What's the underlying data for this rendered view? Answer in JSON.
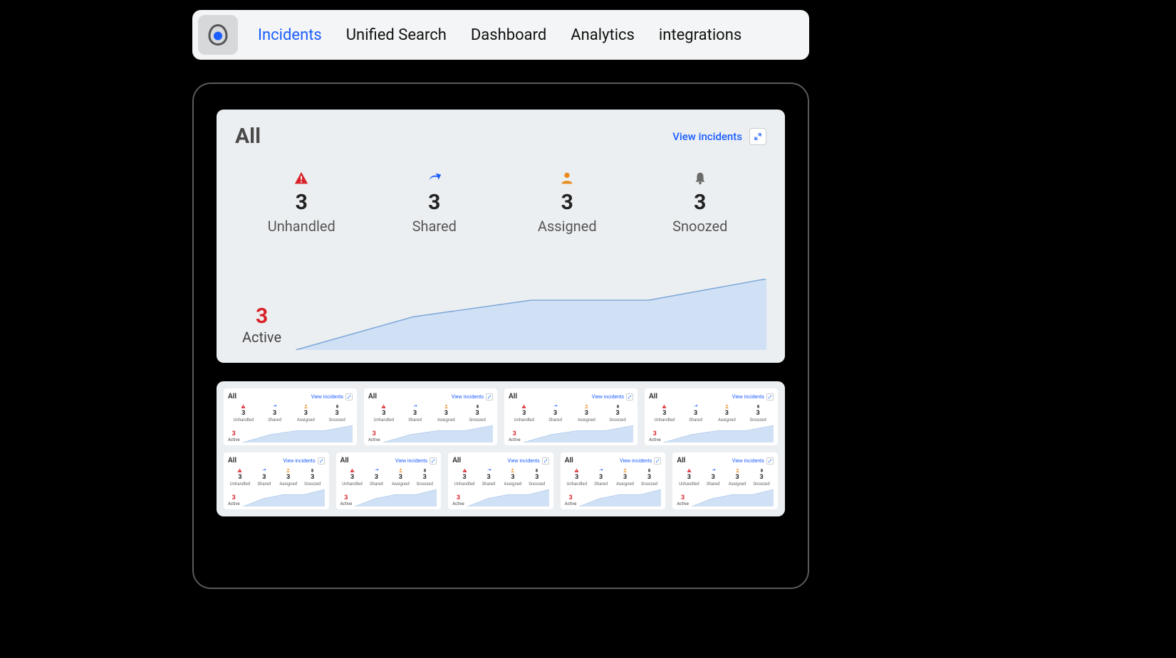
{
  "nav": {
    "items": [
      "Incidents",
      "Unified Search",
      "Dashboard",
      "Analytics",
      "integrations"
    ],
    "active_index": 0
  },
  "main_card": {
    "title": "All",
    "view_link": "View incidents",
    "stats": [
      {
        "icon": "alert",
        "count": "3",
        "label": "Unhandled"
      },
      {
        "icon": "share",
        "count": "3",
        "label": "Shared"
      },
      {
        "icon": "person",
        "count": "3",
        "label": "Assigned"
      },
      {
        "icon": "bell",
        "count": "3",
        "label": "Snoozed"
      }
    ],
    "active": {
      "count": "3",
      "label": "Active"
    }
  },
  "mini_cards": {
    "rows": [
      4,
      5
    ],
    "title": "All",
    "view_link": "View incidents",
    "stats": [
      {
        "icon": "alert",
        "count": "3",
        "label": "Unhandled"
      },
      {
        "icon": "share",
        "count": "3",
        "label": "Shared"
      },
      {
        "icon": "person",
        "count": "3",
        "label": "Assigned"
      },
      {
        "icon": "bell",
        "count": "3",
        "label": "Snoozed"
      }
    ],
    "active": {
      "count": "3",
      "label": "Active"
    }
  },
  "chart_data": {
    "type": "area",
    "title": "",
    "xlabel": "",
    "ylabel": "",
    "x": [
      0,
      1,
      2,
      3,
      4
    ],
    "values": [
      0,
      1.4,
      2.1,
      2.1,
      3
    ],
    "ylim": [
      0,
      3
    ]
  },
  "colors": {
    "accent": "#1b5dff",
    "danger": "#d8232a",
    "warn": "#e8891a",
    "muted": "#6b6b6b",
    "area_fill": "#d0e1f5",
    "area_stroke": "#7fa8d9"
  }
}
